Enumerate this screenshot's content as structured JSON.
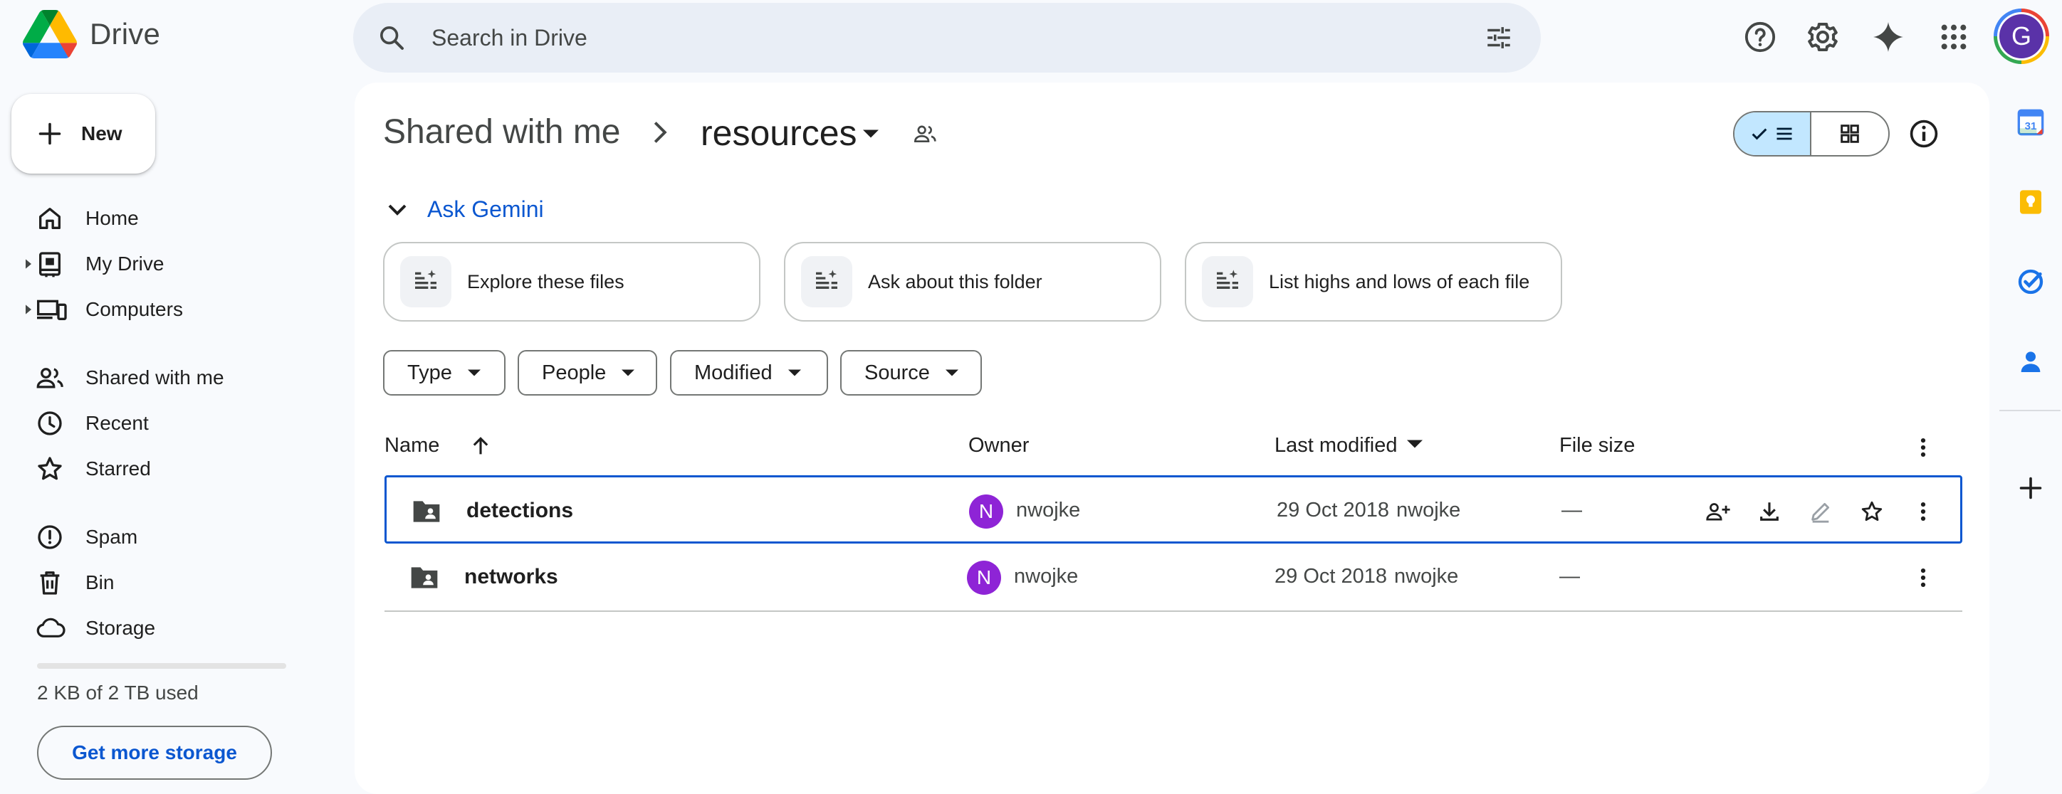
{
  "app": {
    "name": "Drive"
  },
  "search": {
    "placeholder": "Search in Drive"
  },
  "sidebar": {
    "new_label": "New",
    "items": [
      {
        "label": "Home"
      },
      {
        "label": "My Drive"
      },
      {
        "label": "Computers"
      },
      {
        "label": "Shared with me"
      },
      {
        "label": "Recent"
      },
      {
        "label": "Starred"
      },
      {
        "label": "Spam"
      },
      {
        "label": "Bin"
      },
      {
        "label": "Storage"
      }
    ],
    "storage_used": "2 KB of 2 TB used",
    "storage_fraction": 1e-06,
    "get_storage_label": "Get more storage"
  },
  "breadcrumb": {
    "root": "Shared with me",
    "current": "resources"
  },
  "gemini": {
    "label": "Ask Gemini",
    "suggestions": [
      "Explore these files",
      "Ask about this folder",
      "List highs and lows of each file"
    ]
  },
  "filters": [
    "Type",
    "People",
    "Modified",
    "Source"
  ],
  "table": {
    "columns": {
      "name": "Name",
      "owner": "Owner",
      "modified": "Last modified",
      "size": "File size"
    },
    "rows": [
      {
        "name": "detections",
        "owner_initial": "N",
        "owner": "nwojke",
        "modified": "29 Oct 2018",
        "modified_by": "nwojke",
        "size": "—"
      },
      {
        "name": "networks",
        "owner_initial": "N",
        "owner": "nwojke",
        "modified": "29 Oct 2018",
        "modified_by": "nwojke",
        "size": "—"
      }
    ]
  },
  "user": {
    "initial": "G"
  },
  "colors": {
    "accent": "#0b57d0",
    "selected_view": "#c2e7ff",
    "owner_avatar": "#8e24d6",
    "user_avatar": "#5a32a8"
  },
  "side_panel": {
    "calendar_day": "31"
  }
}
